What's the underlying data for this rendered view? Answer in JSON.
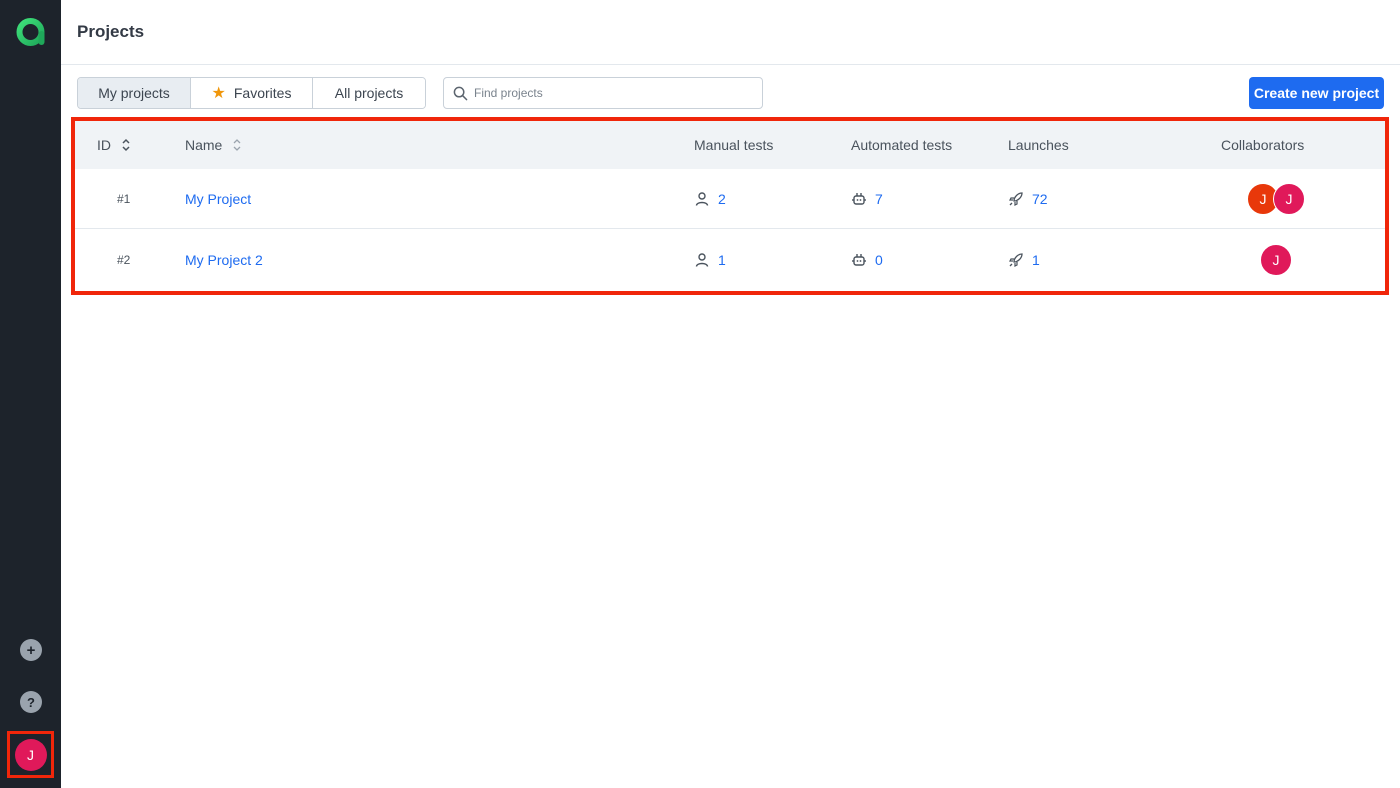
{
  "app": {
    "logo": "allure-logo"
  },
  "header": {
    "title": "Projects"
  },
  "tabs": [
    {
      "label": "My projects",
      "active": true
    },
    {
      "label": "Favorites",
      "icon": "star-icon",
      "active": false
    },
    {
      "label": "All projects",
      "active": false
    }
  ],
  "search": {
    "placeholder": "Find projects",
    "value": ""
  },
  "toolbar": {
    "create_label": "Create new project"
  },
  "table": {
    "columns": [
      "ID",
      "Name",
      "Manual tests",
      "Automated tests",
      "Launches",
      "Collaborators"
    ],
    "rows": [
      {
        "id": "#1",
        "name": "My Project",
        "manual": "2",
        "automated": "7",
        "launches": "72",
        "collaborators": [
          {
            "initial": "J",
            "color": "#e8380a"
          },
          {
            "initial": "J",
            "color": "#e0195a"
          }
        ]
      },
      {
        "id": "#2",
        "name": "My Project 2",
        "manual": "1",
        "automated": "0",
        "launches": "1",
        "collaborators": [
          {
            "initial": "J",
            "color": "#e0195a"
          }
        ]
      }
    ]
  },
  "sidebar": {
    "add_icon": "plus-icon",
    "help_icon": "question-icon",
    "user_initial": "J"
  },
  "colors": {
    "accent": "#1e6bf0",
    "sidebar": "#1d232b",
    "brand": "#2fd16e",
    "highlight": "#f0260a"
  }
}
